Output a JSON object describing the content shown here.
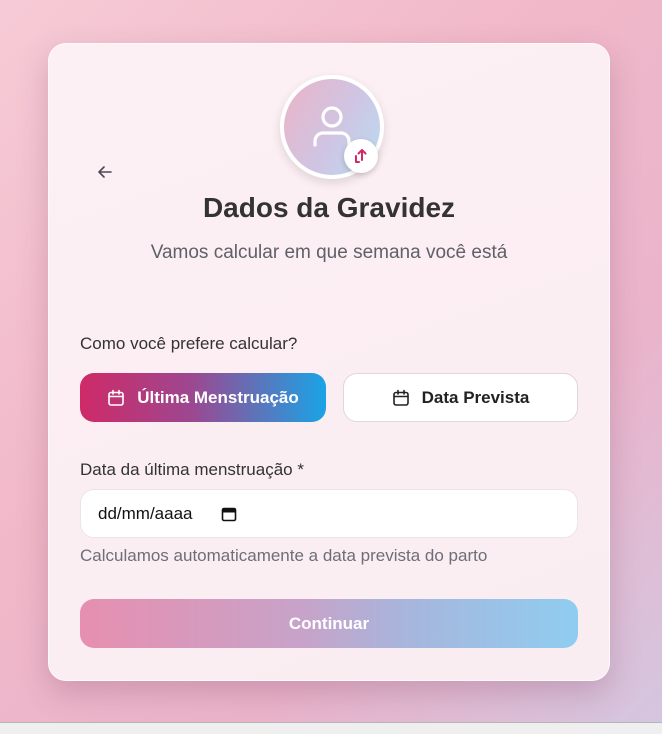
{
  "header": {
    "title": "Dados da Gravidez",
    "subtitle": "Vamos calcular em que semana você está"
  },
  "avatar": {
    "icon": "user-icon",
    "badge_icon": "upload-icon"
  },
  "back": {
    "icon": "arrow-left-icon"
  },
  "calc_method": {
    "question": "Como você prefere calcular?",
    "options": [
      {
        "label": "Última Menstruação",
        "icon": "calendar-icon",
        "selected": true
      },
      {
        "label": "Data Prevista",
        "icon": "calendar-icon",
        "selected": false
      }
    ]
  },
  "date_field": {
    "label": "Data da última menstruação *",
    "placeholder": "dd/mm/aaaa",
    "hint": "Calculamos automaticamente a data prevista do parto"
  },
  "actions": {
    "continue_label": "Continuar"
  },
  "colors": {
    "accent_start": "#cf2a67",
    "accent_end": "#1aa3e6",
    "title": "#333333"
  }
}
